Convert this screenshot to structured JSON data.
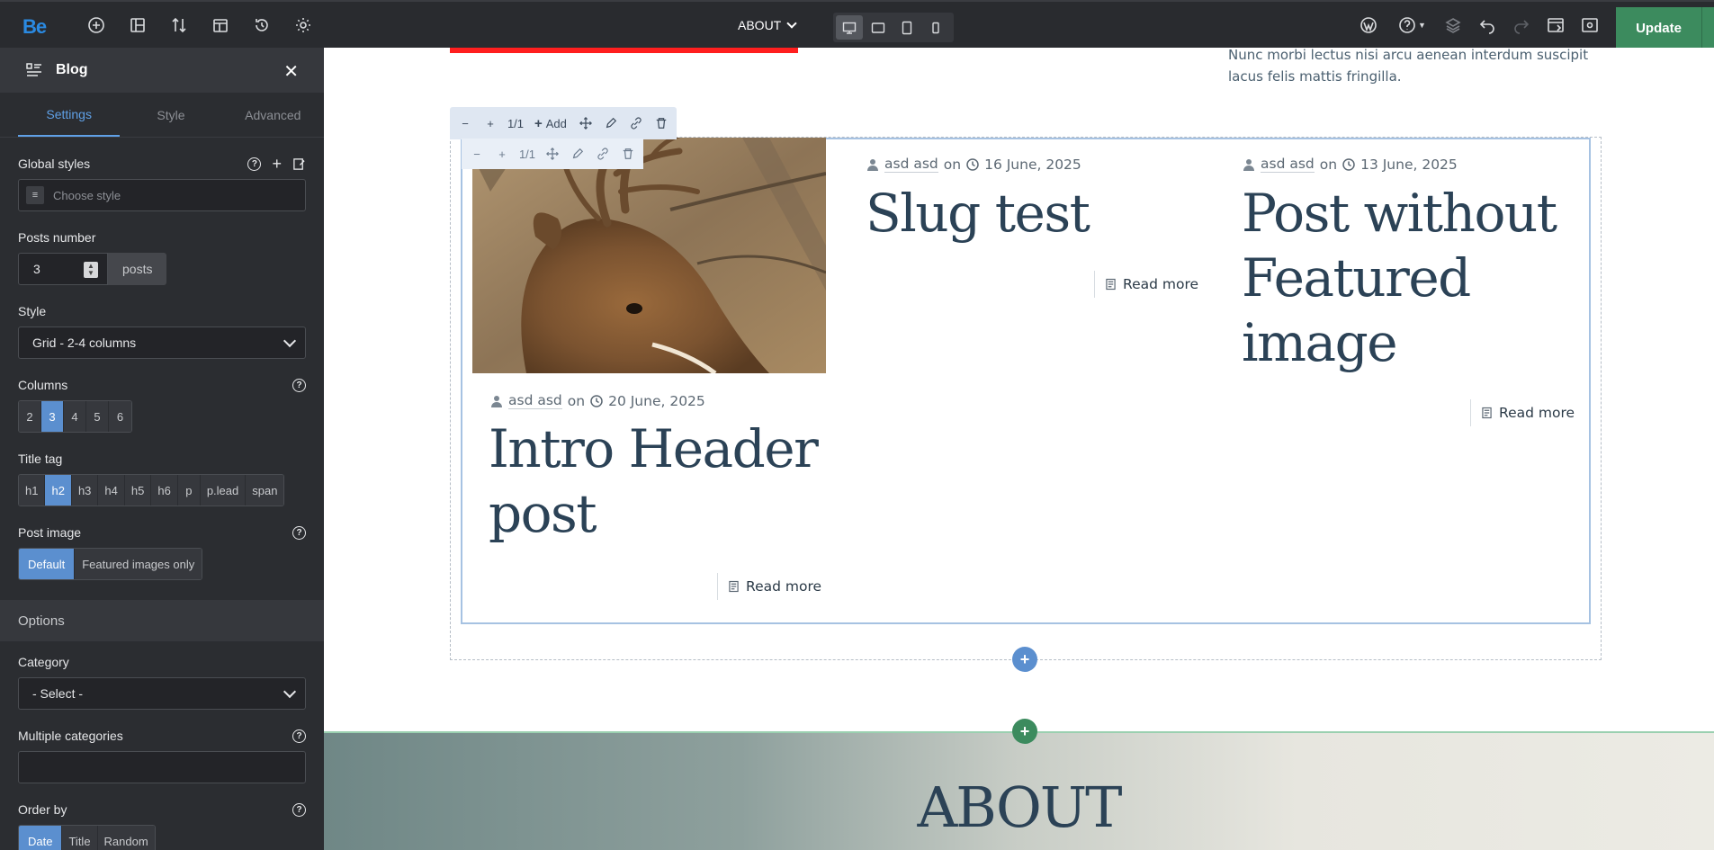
{
  "topbar": {
    "logo": "Be",
    "page_name": "ABOUT",
    "update_label": "Update",
    "icons": [
      "plus-circle-icon",
      "add-section-icon",
      "sort-icon",
      "template-icon",
      "history-icon",
      "settings-icon",
      "wordpress-icon",
      "help-icon",
      "layers-icon",
      "undo-icon",
      "redo-icon",
      "preview-icon",
      "visibility-icon"
    ],
    "devices": [
      "desktop",
      "tablet-landscape",
      "tablet-portrait",
      "mobile"
    ],
    "active_device": "desktop"
  },
  "sidebar": {
    "title": "Blog",
    "tabs": [
      "Settings",
      "Style",
      "Advanced"
    ],
    "active_tab": "Settings",
    "global_styles": {
      "label": "Global styles",
      "placeholder": "Choose style"
    },
    "posts_number": {
      "label": "Posts number",
      "value": "3",
      "unit": "posts"
    },
    "style": {
      "label": "Style",
      "value": "Grid - 2-4 columns"
    },
    "columns": {
      "label": "Columns",
      "options": [
        "2",
        "3",
        "4",
        "5",
        "6"
      ],
      "active": "3"
    },
    "title_tag": {
      "label": "Title tag",
      "options": [
        "h1",
        "h2",
        "h3",
        "h4",
        "h5",
        "h6",
        "p",
        "p.lead",
        "span"
      ],
      "active": "h2"
    },
    "post_image": {
      "label": "Post image",
      "options": [
        "Default",
        "Featured images only"
      ],
      "active": "Default"
    },
    "options_heading": "Options",
    "category": {
      "label": "Category",
      "value": "- Select -"
    },
    "multiple_categories": {
      "label": "Multiple categories",
      "value": ""
    },
    "order_by": {
      "label": "Order by",
      "options": [
        "Date",
        "Title",
        "Random"
      ],
      "active": "Date"
    }
  },
  "canvas": {
    "lorem": "Nunc morbi lectus nisi arcu aenean interdum suscipit lacus felis mattis fringilla.",
    "toolbar_primary": {
      "minus": "−",
      "plus": "+",
      "size": "1/1",
      "add": "Add"
    },
    "toolbar_secondary": {
      "minus": "−",
      "plus": "+",
      "size": "1/1"
    },
    "posts": [
      {
        "author": "asd asd",
        "on": "on",
        "date": "20 June, 2025",
        "title": "Intro Header post",
        "read_more": "Read more",
        "has_image": true
      },
      {
        "author": "asd asd",
        "on": "on",
        "date": "16 June, 2025",
        "title": "Slug test",
        "read_more": "Read more",
        "has_image": false
      },
      {
        "author": "asd asd",
        "on": "on",
        "date": "13 June, 2025",
        "title": "Post without Featured image",
        "read_more": "Read more",
        "has_image": false
      }
    ],
    "about_title": "ABOUT"
  },
  "colors": {
    "accent_blue": "#5b8fcf",
    "update_green": "#3c8b5e",
    "title_navy": "#2b4256",
    "red_bar": "#ff1f1f"
  }
}
